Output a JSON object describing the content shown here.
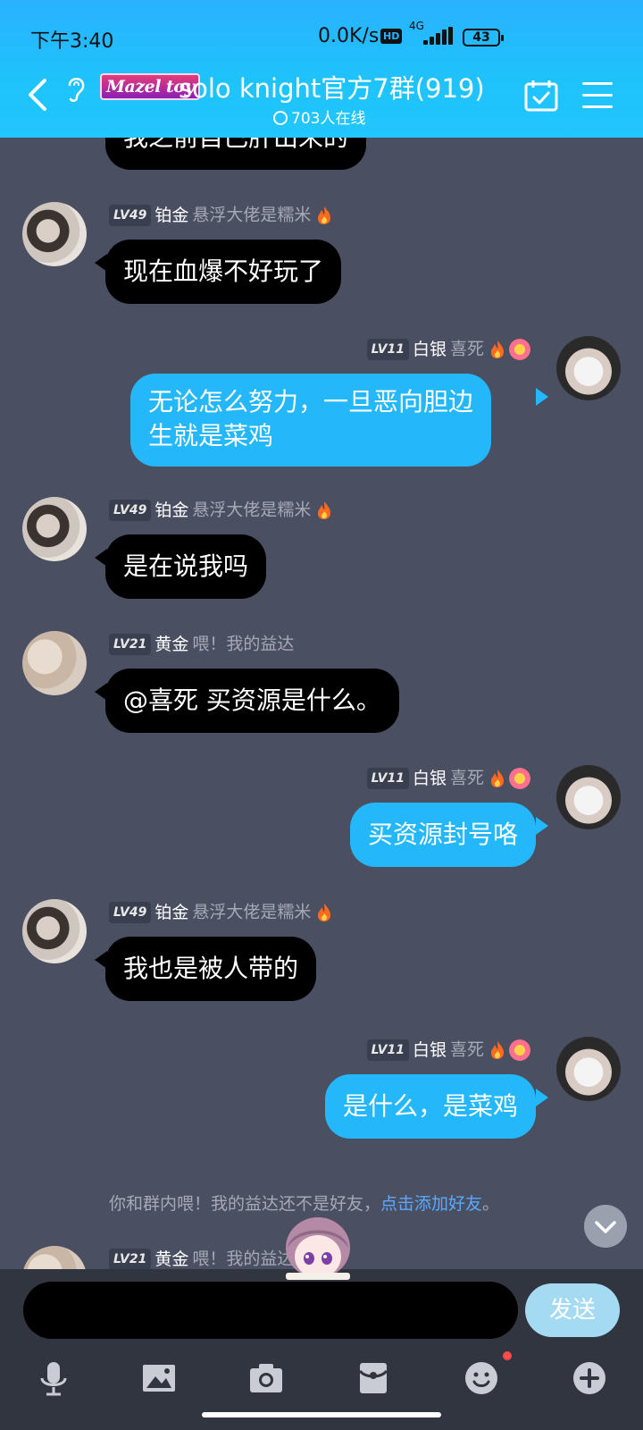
{
  "status_bar": {
    "time": "下午3:40",
    "net_speed": "0.0K/s",
    "hd": "HD",
    "network": "4G",
    "battery": "43"
  },
  "header": {
    "badge": "Mazel toy",
    "title": "solo knight官方7群(919)",
    "online": "703人在线",
    "icons": [
      "back-chevron-icon",
      "ear-icon",
      "calendar-check-icon",
      "menu-icon"
    ]
  },
  "messages": [
    {
      "side": "left",
      "text": "我之前自己肝出来的",
      "partial": true
    },
    {
      "side": "left",
      "level": "LV49",
      "rank": "铂金",
      "title": "悬浮大佬是糯米",
      "text": "现在血爆不好玩了"
    },
    {
      "side": "right",
      "level": "LV11",
      "rank": "白银",
      "title": "喜死",
      "text_lines": [
        "无论怎么努力，一旦恶向胆边",
        "生就是菜鸡"
      ]
    },
    {
      "side": "left",
      "level": "LV49",
      "rank": "铂金",
      "title": "悬浮大佬是糯米",
      "text": "是在说我吗"
    },
    {
      "side": "left",
      "level": "LV21",
      "rank": "黄金",
      "title": "喂！我的益达",
      "text": "@喜死 买资源是什么。"
    },
    {
      "side": "right",
      "level": "LV11",
      "rank": "白银",
      "title": "喜死",
      "text": "买资源封号咯"
    },
    {
      "side": "left",
      "level": "LV49",
      "rank": "铂金",
      "title": "悬浮大佬是糯米",
      "text": "我也是被人带的"
    },
    {
      "side": "right",
      "level": "LV11",
      "rank": "白银",
      "title": "喜死",
      "text": "是什么，是菜鸡"
    },
    {
      "side": "left",
      "level": "LV21",
      "rank": "黄金",
      "title": "喂！我的益达",
      "partial": true
    }
  ],
  "notice": {
    "text": "你和群内喂！我的益达还不是好友，",
    "link": "点击添加好友",
    "suffix": "。"
  },
  "input": {
    "send_label": "发送"
  },
  "toolbar": [
    "microphone-icon",
    "image-icon",
    "camera-icon",
    "red-packet-icon",
    "emoji-icon",
    "plus-icon"
  ]
}
